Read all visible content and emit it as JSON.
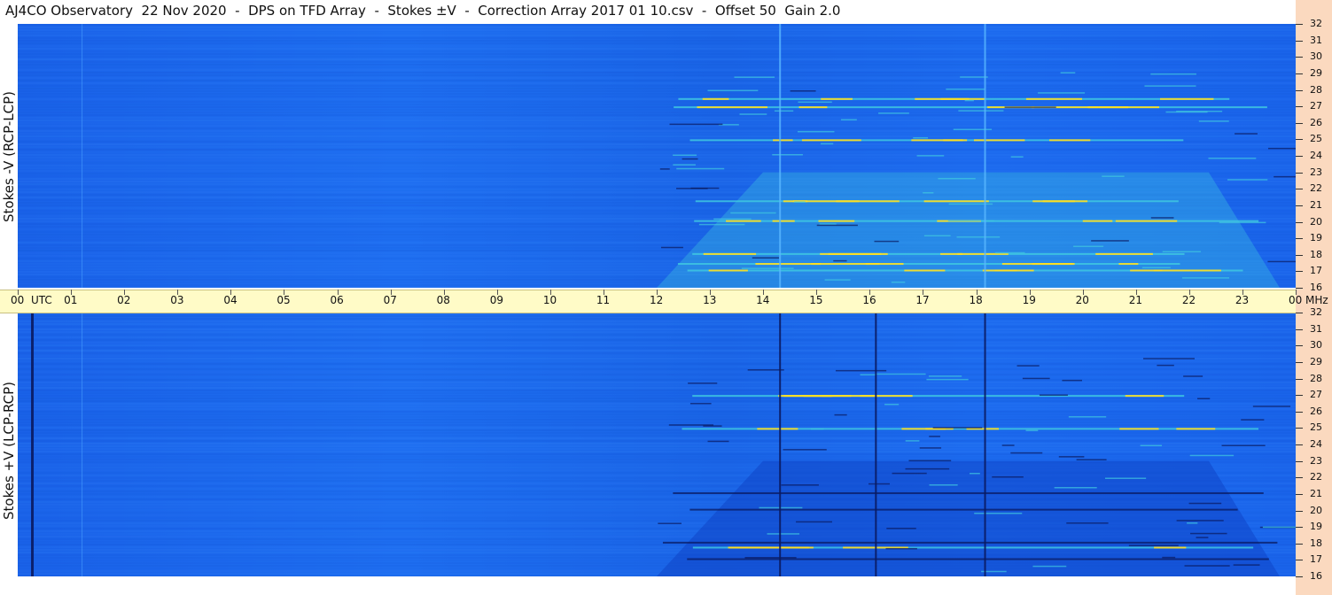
{
  "title": "AJ4CO Observatory  22 Nov 2020  -  DPS on TFD Array  -  Stokes ±V  -  Correction Array 2017 01 10.csv  -  Offset 50  Gain 2.0",
  "chart_data": [
    {
      "type": "heatmap",
      "panel": "top",
      "ylabel": "Stokes -V (RCP-LCP)",
      "x_unit": "UTC",
      "y_unit": "MHz",
      "xlim": [
        0,
        24
      ],
      "ylim": [
        16,
        32
      ],
      "x_ticks": [
        "00",
        "01",
        "02",
        "03",
        "04",
        "05",
        "06",
        "07",
        "08",
        "09",
        "10",
        "11",
        "12",
        "13",
        "14",
        "15",
        "16",
        "17",
        "18",
        "19",
        "20",
        "21",
        "22",
        "23",
        "00"
      ],
      "y_ticks": [
        "32",
        "31",
        "30",
        "29",
        "28",
        "27",
        "26",
        "25",
        "24",
        "23",
        "22",
        "21",
        "20",
        "19",
        "18",
        "17",
        "16"
      ],
      "background_color": "#1a66ea",
      "activity_window_utc": [
        12,
        23.7
      ],
      "bright_lines_mhz": [
        17.1,
        17.5,
        18.1,
        21.3,
        20.1,
        25.0,
        27.0,
        27.5
      ],
      "vertical_lines_utc": [
        14.3,
        18.15
      ]
    },
    {
      "type": "heatmap",
      "panel": "bottom",
      "ylabel": "Stokes +V (LCP-RCP)",
      "x_unit": "UTC",
      "y_unit": "MHz",
      "xlim": [
        0,
        24
      ],
      "ylim": [
        16,
        32
      ],
      "x_ticks": [
        "00",
        "01",
        "02",
        "03",
        "04",
        "05",
        "06",
        "07",
        "08",
        "09",
        "10",
        "11",
        "12",
        "13",
        "14",
        "15",
        "16",
        "17",
        "18",
        "19",
        "20",
        "21",
        "22",
        "23",
        "00"
      ],
      "y_ticks": [
        "32",
        "31",
        "30",
        "29",
        "28",
        "27",
        "26",
        "25",
        "24",
        "23",
        "22",
        "21",
        "20",
        "19",
        "18",
        "17",
        "16"
      ],
      "background_color": "#1a66ea",
      "activity_window_utc": [
        12,
        23.7
      ],
      "bright_lines_mhz": [
        17.8,
        25.0,
        27.0
      ],
      "dark_lines_mhz": [
        17.1,
        18.1,
        21.1,
        20.1
      ],
      "vertical_lines_utc": [
        0.25,
        14.3,
        16.1,
        18.15
      ]
    }
  ],
  "axis": {
    "utc_unit_label": "UTC",
    "mhz_unit_label": "MHz"
  },
  "colors": {
    "time_bar": "#fffbc7",
    "right_strip": "#fbd9bf",
    "heat_low": "#1a66ea",
    "heat_mid": "#40c8e0",
    "heat_high": "#ffe020",
    "heat_dark": "#0a1a60"
  }
}
